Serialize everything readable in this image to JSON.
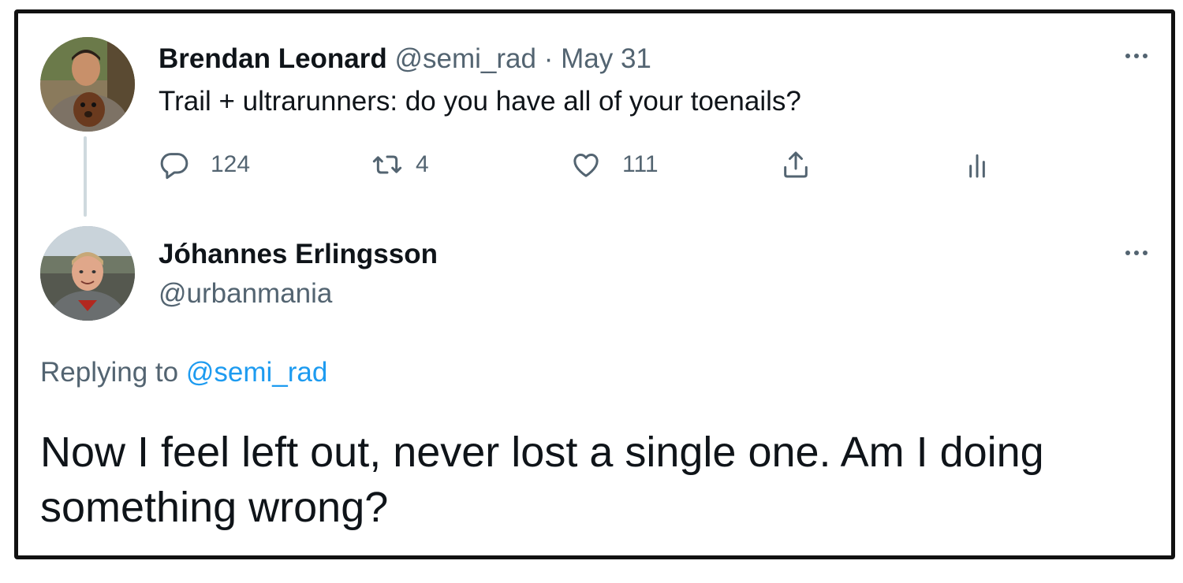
{
  "original_tweet": {
    "author_name": "Brendan Leonard",
    "handle": "@semi_rad",
    "separator": "·",
    "date": "May 31",
    "text": "Trail + ultrarunners: do you have all of your toenails?",
    "actions": {
      "replies": "124",
      "retweets": "4",
      "likes": "111"
    },
    "icons": [
      "avatar",
      "more-icon",
      "reply-icon",
      "retweet-icon",
      "like-icon",
      "share-icon",
      "analytics-icon"
    ]
  },
  "reply_tweet": {
    "author_name": "Jóhannes Erlingsson",
    "handle": "@urbanmania",
    "replying_prefix": "Replying to",
    "replying_to": "@semi_rad",
    "text": "Now I feel left out, never lost a single one. Am I doing something wrong?",
    "icons": [
      "avatar",
      "more-icon"
    ]
  },
  "colors": {
    "text": "#0f1419",
    "muted": "#536471",
    "link": "#1d9bf0",
    "thread_line": "#cfd9de",
    "frame_border": "#111111"
  }
}
